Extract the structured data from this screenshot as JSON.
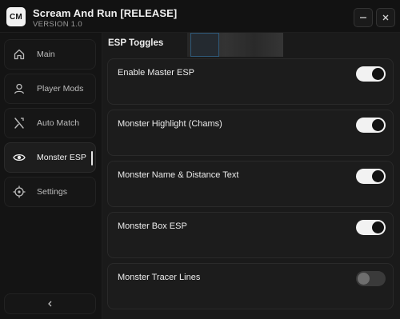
{
  "app": {
    "logo_text": "CM",
    "title": "Scream And Run [RELEASE]",
    "version": "VERSION 1.0",
    "minimize_icon": "minus-icon",
    "close_icon": "close-icon"
  },
  "sidebar": {
    "items": [
      {
        "label": "Main",
        "icon": "home-icon",
        "active": false
      },
      {
        "label": "Player Mods",
        "icon": "user-icon",
        "active": false
      },
      {
        "label": "Auto Match",
        "icon": "crossed-arrows-icon",
        "active": false
      },
      {
        "label": "Monster ESP",
        "icon": "eye-icon",
        "active": true
      },
      {
        "label": "Settings",
        "icon": "crosshair-icon",
        "active": false
      }
    ],
    "collapse_icon": "chevron-left-icon"
  },
  "main": {
    "section_title": "ESP Toggles",
    "toggles": [
      {
        "label": "Enable Master ESP",
        "on": true
      },
      {
        "label": "Monster Highlight (Chams)",
        "on": true
      },
      {
        "label": "Monster Name & Distance Text",
        "on": true
      },
      {
        "label": "Monster Box ESP",
        "on": true
      },
      {
        "label": "Monster Tracer Lines",
        "on": false
      }
    ]
  },
  "colors": {
    "background": "#151515",
    "card": "#1c1c1c",
    "toggle_on": "#f2f2f2",
    "toggle_off": "#3a3a3a"
  }
}
